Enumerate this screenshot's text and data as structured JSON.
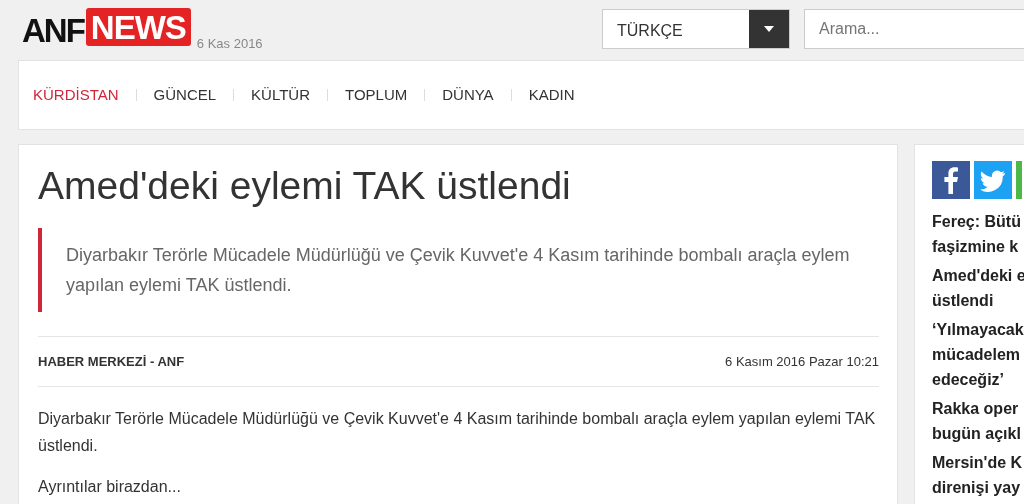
{
  "header": {
    "logo": {
      "part_1": "ANF",
      "part_2": "NEWS"
    },
    "date": "6 Kas 2016",
    "language": {
      "value": "TÜRKÇE"
    },
    "search": {
      "placeholder": "Arama..."
    }
  },
  "nav": [
    {
      "label": "KÜRDİSTAN",
      "selected": true
    },
    {
      "label": "GÜNCEL",
      "selected": false
    },
    {
      "label": "KÜLTÜR",
      "selected": false
    },
    {
      "label": "TOPLUM",
      "selected": false
    },
    {
      "label": "DÜNYA",
      "selected": false
    },
    {
      "label": "KADIN",
      "selected": false
    }
  ],
  "article": {
    "title": "Amed'deki eylemi TAK üstlendi",
    "summary": "Diyarbakır Terörle Mücadele Müdürlüğü ve Çevik Kuvvet'e 4 Kasım tarihinde bombalı araçla eylem yapılan eylemi TAK üstlendi.",
    "source": "HABER MERKEZİ - ANF",
    "datetime": "6 Kasım 2016 Pazar 10:21",
    "paragraphs": [
      "Diyarbakır Terörle Mücadele Müdürlüğü ve Çevik Kuvvet'e 4 Kasım tarihinde bombalı araçla eylem yapılan eylemi TAK üstlendi.",
      "Ayrıntılar birazdan..."
    ]
  },
  "sidebar": {
    "share": [
      {
        "kind": "facebook"
      },
      {
        "kind": "twitter"
      },
      {
        "kind": "other"
      }
    ],
    "headlines": [
      {
        "lines": [
          "Fereç: Bütü",
          "faşizmine k"
        ]
      },
      {
        "lines": [
          "Amed'deki e",
          "üstlendi"
        ]
      },
      {
        "lines": [
          "‘Yılmayacak",
          "mücadelem",
          "edeceğiz’"
        ]
      },
      {
        "lines": [
          "Rakka oper",
          "bugün açıkl"
        ]
      },
      {
        "lines": [
          "Mersin'de K",
          "direnişi yay"
        ]
      }
    ]
  }
}
